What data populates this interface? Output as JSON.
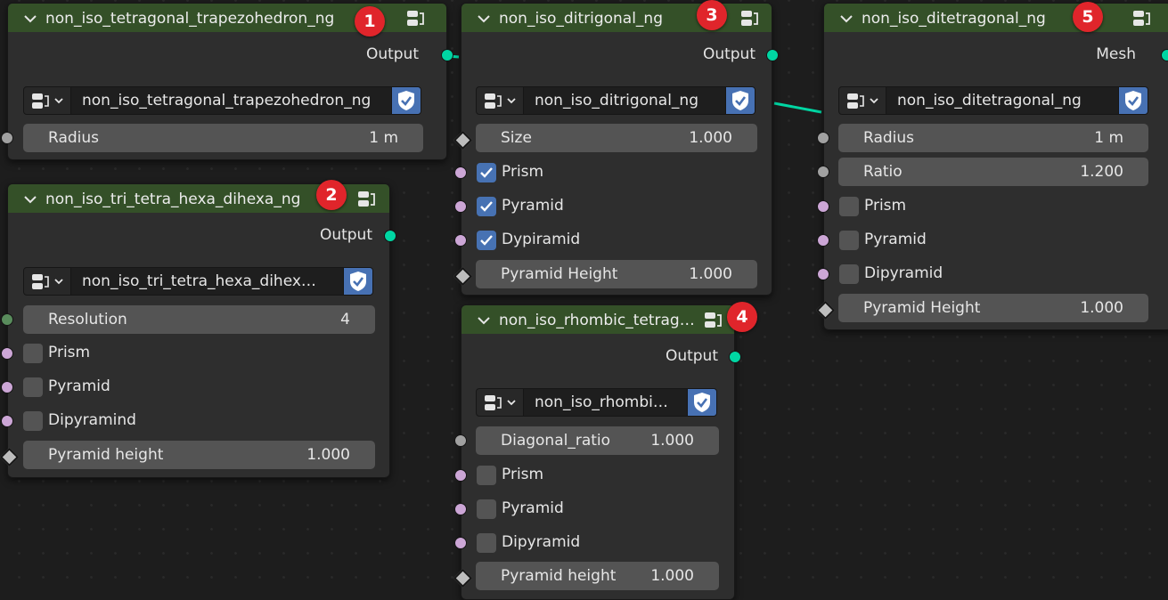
{
  "nodes": {
    "n1": {
      "title": "non_iso_tetragonal_trapezohedron_ng",
      "badge": "1",
      "output": "Output",
      "group": "non_iso_tetragonal_trapezohedron_ng",
      "radius": {
        "label": "Radius",
        "value": "1 m"
      }
    },
    "n2": {
      "title": "non_iso_tri_tetra_hexa_dihexa_ng",
      "badge": "2",
      "output": "Output",
      "group": "non_iso_tri_tetra_hexa_dihex…",
      "resolution": {
        "label": "Resolution",
        "value": "4"
      },
      "prism": {
        "label": "Prism",
        "checked": false
      },
      "pyramid": {
        "label": "Pyramid",
        "checked": false
      },
      "dipyramid": {
        "label": "Dipyramind",
        "checked": false
      },
      "height": {
        "label": "Pyramid height",
        "value": "1.000"
      }
    },
    "n3": {
      "title": "non_iso_ditrigonal_ng",
      "badge": "3",
      "output": "Output",
      "group": "non_iso_ditrigonal_ng",
      "size": {
        "label": "Size",
        "value": "1.000"
      },
      "prism": {
        "label": "Prism",
        "checked": true
      },
      "pyramid": {
        "label": "Pyramid",
        "checked": true
      },
      "dipyramid": {
        "label": "Dypiramid",
        "checked": true
      },
      "height": {
        "label": "Pyramid Height",
        "value": "1.000"
      }
    },
    "n4": {
      "title": "non_iso_rhombic_tetrag…",
      "badge": "4",
      "output": "Output",
      "group": "non_iso_rhombi…",
      "ratio": {
        "label": "Diagonal_ratio",
        "value": "1.000"
      },
      "prism": {
        "label": "Prism",
        "checked": false
      },
      "pyramid": {
        "label": "Pyramid",
        "checked": false
      },
      "dipyramid": {
        "label": "Dipyramid",
        "checked": false
      },
      "height": {
        "label": "Pyramid height",
        "value": "1.000"
      }
    },
    "n5": {
      "title": "non_iso_ditetragonal_ng",
      "badge": "5",
      "output": "Mesh",
      "group": "non_iso_ditetragonal_ng",
      "radius": {
        "label": "Radius",
        "value": "1 m"
      },
      "ratio": {
        "label": "Ratio",
        "value": "1.200"
      },
      "prism": {
        "label": "Prism",
        "checked": false
      },
      "pyramid": {
        "label": "Pyramid",
        "checked": false
      },
      "dipyramid": {
        "label": "Dipyramid",
        "checked": false
      },
      "height": {
        "label": "Pyramid Height",
        "value": "1.000"
      }
    }
  },
  "colors": {
    "header": "#345028",
    "geometry_socket": "#00d6a3",
    "float_socket": "#a1a1a1",
    "bool_socket": "#cca6d6",
    "int_socket": "#598c5c",
    "checkbox_checked": "#4772b3",
    "badge": "#e0252b"
  },
  "icons": {
    "collapse": "chevron-down-icon",
    "node_group": "node-tree-icon",
    "fake_user": "shield-check-icon"
  }
}
